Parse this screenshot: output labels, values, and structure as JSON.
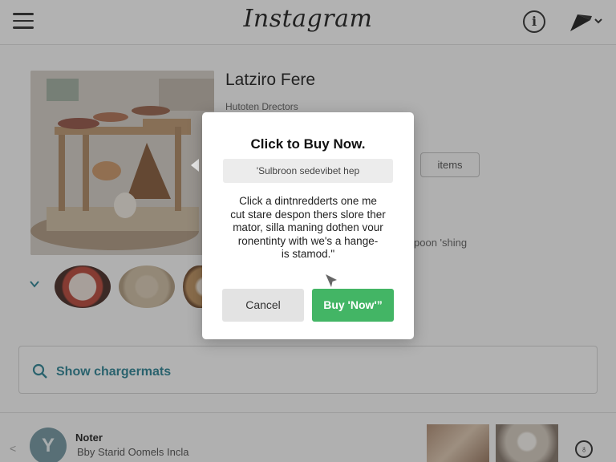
{
  "header": {
    "brand": "Instagram",
    "menu_icon": "hamburger-menu-icon",
    "info_icon": "info-icon",
    "info_glyph": "i",
    "share_icon": "send-share-icon"
  },
  "product": {
    "title": "Latziro Fere",
    "subtitle": "Hutoten Drectors",
    "items_button": "items",
    "side_text": "poon 'shing"
  },
  "search": {
    "label": "Show chargermats",
    "icon": "search-icon"
  },
  "bottom": {
    "avatar_letter": "Y",
    "note_title": "Noter",
    "note_subtitle": "Bby Starid Oomels Incla",
    "action_icon": "leaf-badge-icon",
    "action_glyph": "♁"
  },
  "modal": {
    "title": "Click to Buy Now.",
    "input_value": "'Sulbroon sedevibet hep",
    "body_lines": [
      "Click a dintnredderts one me",
      "cut stare despon thers slore ther",
      "mator, silla maning dothen vour",
      "ronentinty with we's a hange-",
      "is stamod.\""
    ],
    "cancel_label": "Cancel",
    "buy_label": "Buy 'Now'”"
  },
  "colors": {
    "accent_green": "#43b565",
    "search_teal": "#1f7a8c",
    "overlay": "rgba(60,60,60,0.38)"
  }
}
